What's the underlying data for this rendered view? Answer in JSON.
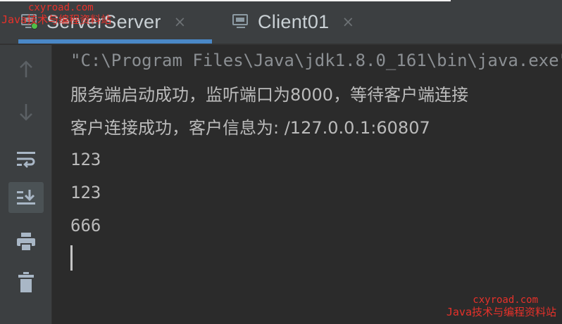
{
  "tabs": [
    {
      "label": "ServerServer",
      "close": "×",
      "active": true
    },
    {
      "label": "Client01",
      "close": "×",
      "active": false
    }
  ],
  "toolbar": {
    "icons": [
      "arrow-up-icon",
      "arrow-down-icon",
      "soft-wrap-icon",
      "scroll-to-end-icon",
      "print-icon",
      "trash-icon"
    ]
  },
  "console": {
    "lines": [
      "\"C:\\Program Files\\Java\\jdk1.8.0_161\\bin\\java.exe\"",
      "服务端启动成功，监听端口为8000，等待客户端连接",
      "客户连接成功，客户信息为: /127.0.0.1:60807",
      "123",
      "123",
      "666"
    ]
  },
  "watermark": {
    "site": "cxyroad.com",
    "name": "Java技术与编程资料站"
  },
  "colors": {
    "background": "#2b2b2b",
    "toolbar": "#3c3f41",
    "accent": "#4a88c7",
    "watermark": "#e8312a"
  }
}
